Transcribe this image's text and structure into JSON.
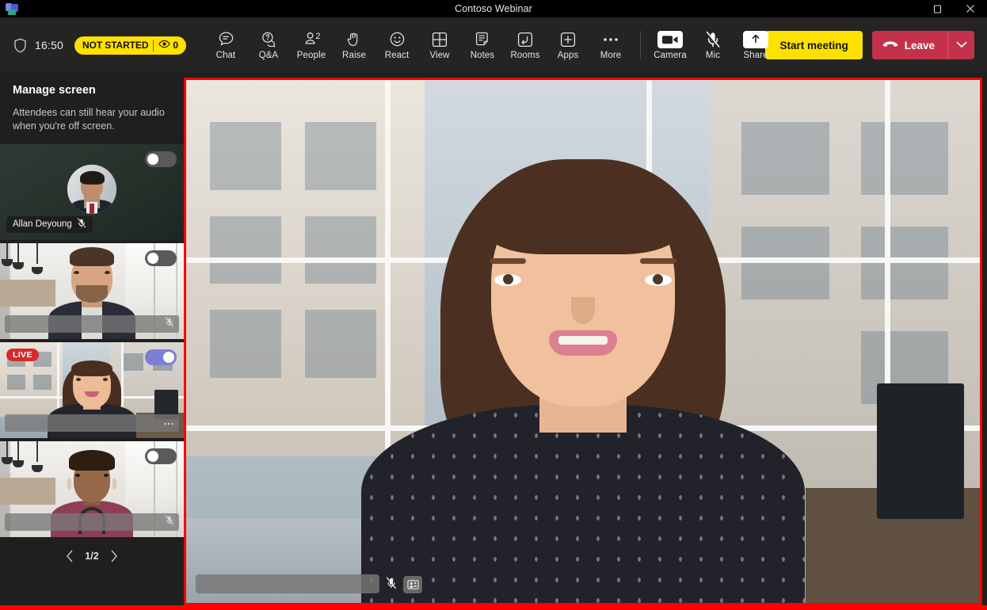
{
  "window": {
    "title": "Contoso Webinar",
    "app_icon": "teams-logo",
    "controls": {
      "maximize": "maximize",
      "close": "close"
    }
  },
  "toolbar": {
    "shield_icon": "shield-icon",
    "clock": "16:50",
    "status_badge": {
      "label": "NOT STARTED",
      "eye_icon": "eye-icon",
      "viewer_count": "0",
      "bg_color": "#ffe100"
    },
    "items": [
      {
        "label": "Chat",
        "icon": "chat-icon"
      },
      {
        "label": "Q&A",
        "icon": "qa-icon"
      },
      {
        "label": "People",
        "icon": "people-icon",
        "badge": "2"
      },
      {
        "label": "Raise",
        "icon": "raise-hand-icon"
      },
      {
        "label": "React",
        "icon": "react-smiley-icon"
      },
      {
        "label": "View",
        "icon": "view-grid-icon"
      },
      {
        "label": "Notes",
        "icon": "notes-icon"
      },
      {
        "label": "Rooms",
        "icon": "rooms-icon"
      },
      {
        "label": "Apps",
        "icon": "apps-plus-icon"
      },
      {
        "label": "More",
        "icon": "more-ellipsis-icon"
      }
    ],
    "media": [
      {
        "label": "Camera",
        "icon": "camera-icon",
        "state": "on"
      },
      {
        "label": "Mic",
        "icon": "mic-muted-icon",
        "state": "muted"
      },
      {
        "label": "Share",
        "icon": "share-up-arrow-icon",
        "state": "on"
      }
    ],
    "start_meeting": {
      "label": "Start meeting",
      "bg_color": "#ffe100"
    },
    "leave": {
      "label": "Leave",
      "icon": "phone-hangup-icon",
      "bg_color": "#c4314b",
      "caret_icon": "chevron-down-icon"
    }
  },
  "sidebar": {
    "panel_title": "Manage screen",
    "panel_subtitle": "Attendees can still hear your audio when you're off screen.",
    "tiles": [
      {
        "name": "Allan Deyoung",
        "kind": "avatar",
        "toggle": "off",
        "live": false,
        "mic": "muted",
        "name_hidden": false
      },
      {
        "name": "",
        "kind": "video-man",
        "toggle": "off",
        "live": false,
        "mic": "muted",
        "name_hidden": true
      },
      {
        "name": "",
        "kind": "video-woman",
        "toggle": "on",
        "live": true,
        "live_label": "LIVE",
        "mic": "muted",
        "name_hidden": true,
        "selected": true
      },
      {
        "name": "",
        "kind": "video-curly",
        "toggle": "off",
        "live": false,
        "mic": "muted",
        "name_hidden": true
      }
    ],
    "pagination": {
      "prev_icon": "chevron-left-icon",
      "label": "1/2",
      "next_icon": "chevron-right-icon"
    }
  },
  "stage": {
    "speaker_name_hidden": true,
    "mic_icon": "mic-muted-icon",
    "pin_icon": "pinned-people-icon",
    "highlight_color": "#ff0000"
  }
}
